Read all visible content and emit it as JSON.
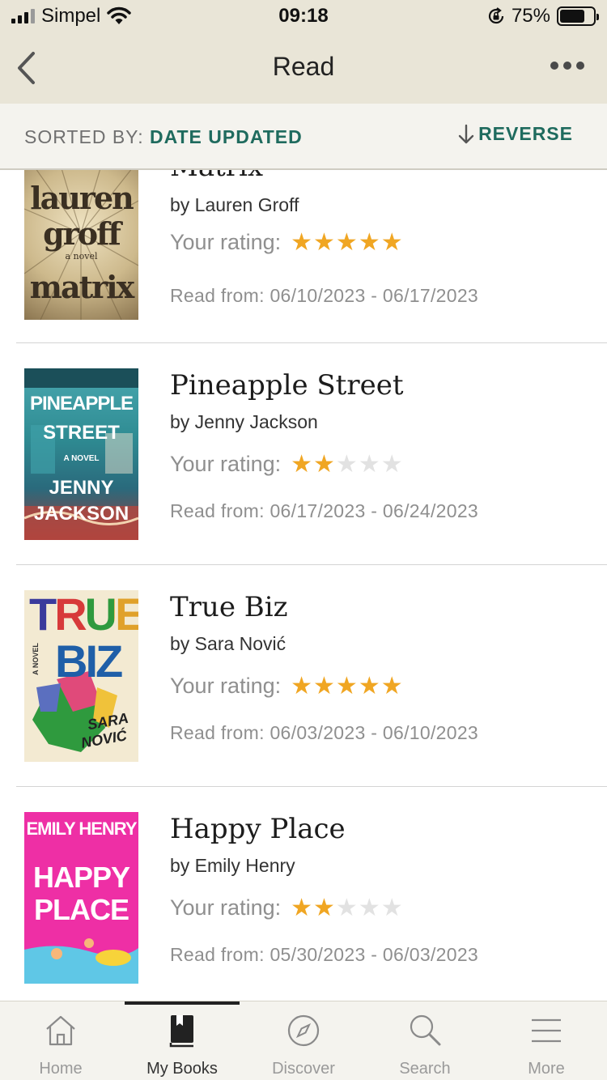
{
  "status_bar": {
    "carrier": "Simpel",
    "time": "09:18",
    "battery_percent": "75%",
    "battery_level": 0.75
  },
  "nav": {
    "title": "Read"
  },
  "sort_bar": {
    "label": "SORTED BY:",
    "value": "DATE UPDATED",
    "reverse_label": "REVERSE"
  },
  "books": [
    {
      "title": "Matrix",
      "author": "by Lauren Groff",
      "rating_label": "Your rating:",
      "rating": 5,
      "read_dates": "Read from: 06/10/2023 - 06/17/2023",
      "cover": {
        "top_text": "lauren",
        "mid_text": "groff",
        "bottom_text": "matrix",
        "subtitle": "a novel",
        "bg": "#c9b58a",
        "fg": "#3a2f22"
      }
    },
    {
      "title": "Pineapple Street",
      "author": "by Jenny Jackson",
      "rating_label": "Your rating:",
      "rating": 2,
      "read_dates": "Read from: 06/17/2023 - 06/24/2023",
      "cover": {
        "line1": "PINEAPPLE",
        "line2": "STREET",
        "line3": "A NOVEL",
        "line4": "JENNY",
        "line5": "JACKSON",
        "bg": "#2f8c93",
        "fg": "#ffffff"
      }
    },
    {
      "title": "True Biz",
      "author": "by Sara Nović",
      "rating_label": "Your rating:",
      "rating": 5,
      "read_dates": "Read from: 06/03/2023 - 06/10/2023",
      "cover": {
        "line1": "TRUE",
        "line2": "BIZ",
        "side": "A NOVEL",
        "author1": "SARA",
        "author2": "NOVIĆ",
        "bg": "#f3ead2"
      }
    },
    {
      "title": "Happy Place",
      "author": "by Emily Henry",
      "rating_label": "Your rating:",
      "rating": 2,
      "read_dates": "Read from: 05/30/2023 - 06/03/2023",
      "cover": {
        "line1": "EMILY HENRY",
        "line2": "HAPPY",
        "line3": "PLACE",
        "bg": "#ee2fa5",
        "fg": "#ffffff"
      }
    }
  ],
  "tabs": [
    {
      "label": "Home",
      "icon": "home-icon",
      "active": false
    },
    {
      "label": "My Books",
      "icon": "my-books-icon",
      "active": true
    },
    {
      "label": "Discover",
      "icon": "compass-icon",
      "active": false
    },
    {
      "label": "Search",
      "icon": "search-icon",
      "active": false
    },
    {
      "label": "More",
      "icon": "menu-icon",
      "active": false
    }
  ],
  "colors": {
    "header_bg": "#e9e5d7",
    "accent_green": "#1f6b5e",
    "star_on": "#f0a623",
    "star_off": "#e2e2e2"
  }
}
